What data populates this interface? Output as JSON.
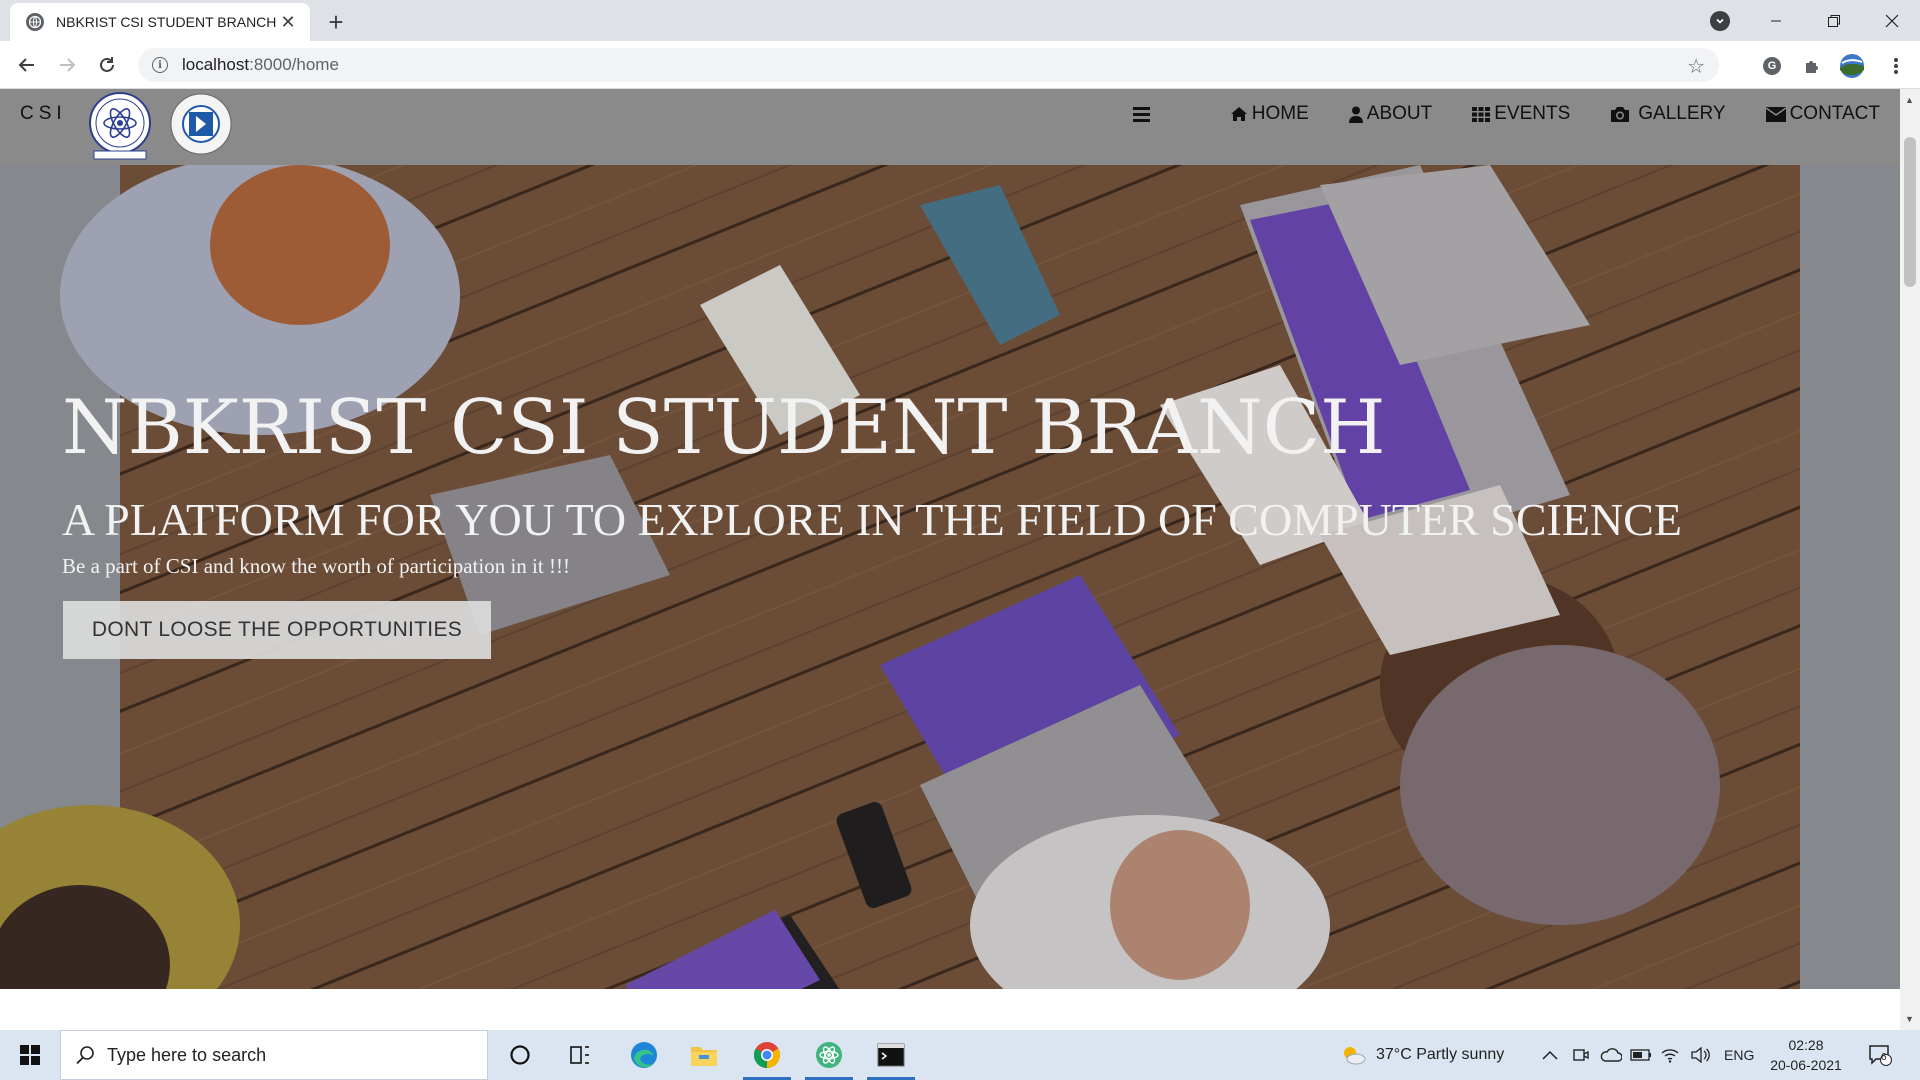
{
  "browser": {
    "tab_title": "NBKRIST CSI STUDENT BRANCH",
    "tab_close": "✕",
    "new_tab": "+",
    "url_host": "localhost",
    "url_rest": ":8000/home",
    "profile_letter": "G"
  },
  "site": {
    "brand": "CSI",
    "nav": [
      {
        "label": "HOME",
        "icon": "home-icon"
      },
      {
        "label": "ABOUT",
        "icon": "user-icon"
      },
      {
        "label": "EVENTS",
        "icon": "grid-icon"
      },
      {
        "label": "GALLERY",
        "icon": "camera-icon"
      },
      {
        "label": "CONTACT",
        "icon": "envelope-icon"
      }
    ]
  },
  "hero": {
    "title": "NBKRIST CSI STUDENT BRANCH",
    "subtitle": "A PLATFORM FOR YOU TO EXPLORE IN THE FIELD OF COMPUTER SCIENCE",
    "tagline": "Be a part of CSI and know the worth of participation in it !!!",
    "cta": "DONT LOOSE THE OPPORTUNITIES"
  },
  "taskbar": {
    "search_placeholder": "Type here to search",
    "weather": "37°C  Partly sunny",
    "lang": "ENG",
    "time": "02:28",
    "date": "20-06-2021",
    "notifications": "6"
  }
}
